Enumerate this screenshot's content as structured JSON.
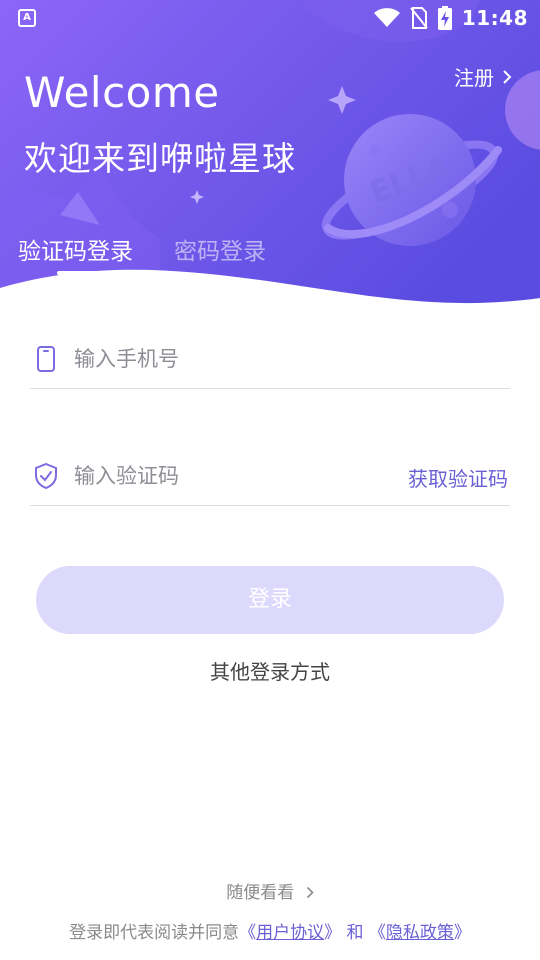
{
  "status_bar": {
    "time": "11:48",
    "app_icon_label": "A"
  },
  "header": {
    "register_label": "注册",
    "welcome_title": "Welcome",
    "welcome_subtitle": "欢迎来到咿啦星球",
    "planet_text": "ELLA"
  },
  "tabs": [
    {
      "label": "验证码登录",
      "active": true
    },
    {
      "label": "密码登录",
      "active": false
    }
  ],
  "form": {
    "phone_placeholder": "输入手机号",
    "phone_value": "",
    "code_placeholder": "输入验证码",
    "code_value": "",
    "get_code_label": "获取验证码",
    "login_button_label": "登录"
  },
  "other_login_label": "其他登录方式",
  "browse_label": "随便看看",
  "agreement": {
    "prefix": "登录即代表阅读并同意",
    "user_agreement": "用户协议",
    "and": "和",
    "privacy_policy": "隐私政策",
    "bracket_open": "《",
    "bracket_close": "》"
  },
  "colors": {
    "header_gradient_start": "#8a64f4",
    "header_gradient_end": "#5b4de0",
    "accent": "#6b5fd6",
    "login_button_disabled": "#dcd9fd"
  },
  "icons": {
    "status": [
      "wifi-icon",
      "no-sim-icon",
      "battery-charging-icon"
    ],
    "phone_field": "phone-icon",
    "code_field": "shield-check-icon",
    "register_chevron": "chevron-right-icon",
    "browse_chevron": "chevron-right-icon"
  }
}
